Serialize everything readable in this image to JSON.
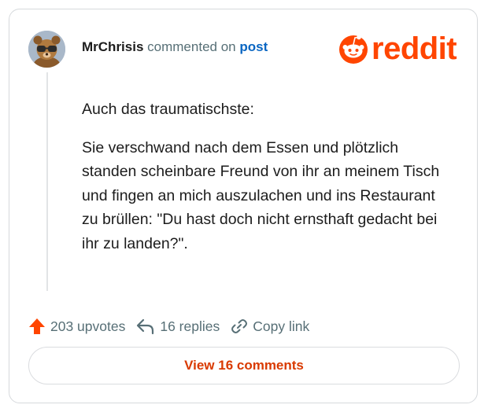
{
  "header": {
    "username": "MrChrisis",
    "verb": "commented on",
    "target": "post"
  },
  "brand": {
    "wordmark": "reddit",
    "color": "#ff4500"
  },
  "comment": {
    "paragraphs": [
      "Auch das traumatischste:",
      "Sie verschwand nach dem Essen und plötzlich standen scheinbare Freund von ihr an meinem Tisch und fingen an mich auszulachen und ins Restaurant zu brüllen: \"Du hast doch nicht ernsthaft gedacht bei ihr zu landen?\"."
    ]
  },
  "actions": {
    "upvotes": "203 upvotes",
    "replies": "16 replies",
    "copy_link": "Copy link"
  },
  "view_comments_label": "View 16 comments",
  "icons": {
    "upvote": "upvote-arrow-icon",
    "reply": "reply-arrow-icon",
    "copy": "link-icon",
    "logo": "reddit-snoo-icon",
    "avatar": "avatar-image"
  },
  "colors": {
    "accent": "#ff4500",
    "button_text": "#d93a00",
    "link": "#0a66c2"
  }
}
